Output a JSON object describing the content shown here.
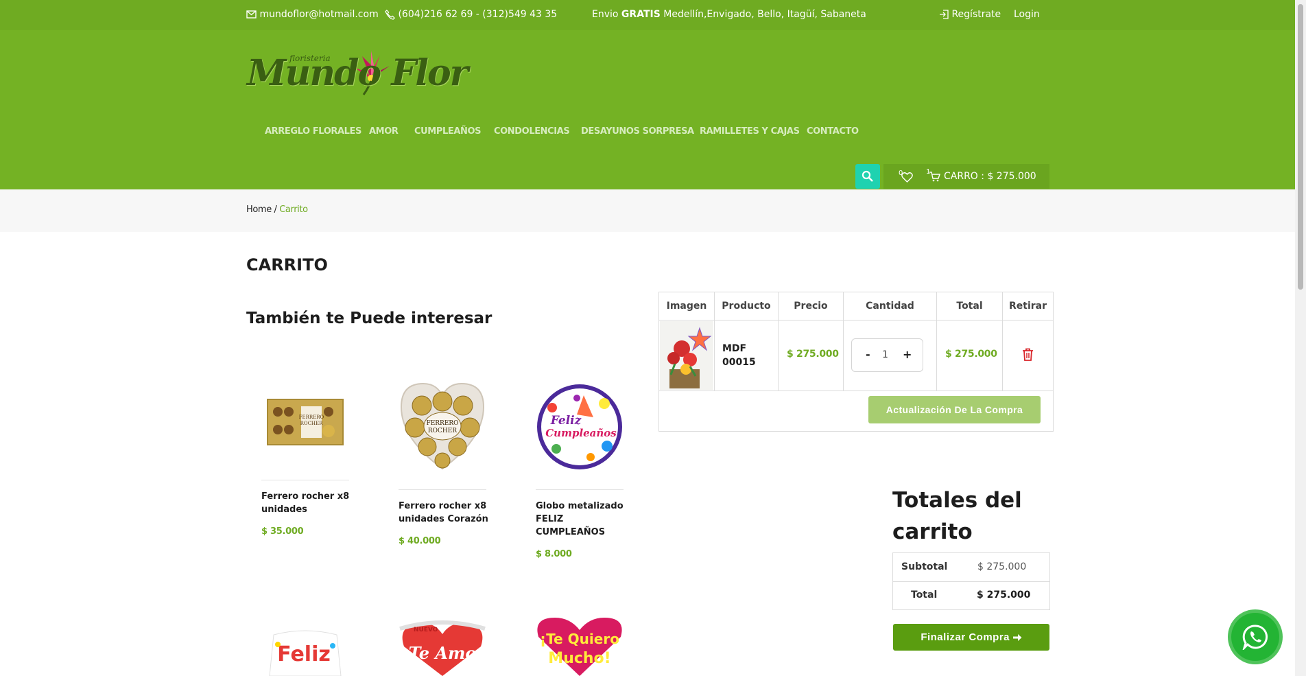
{
  "topbar": {
    "email": "mundoflor@hotmail.com",
    "phone": "(604)216 62 69 - (312)549 43 35",
    "shipping_prefix": "Envio",
    "shipping_bold": "GRATIS",
    "shipping_cities": "Medellín,Envigado, Bello, Itagüí, Sabaneta",
    "register": "Regístrate",
    "login": "Login"
  },
  "logo": {
    "small": "floristeria",
    "main": "Mundo Flor"
  },
  "nav": [
    "ARREGLO FLORALES",
    "AMOR",
    "CUMPLEAÑOS",
    "CONDOLENCIAS",
    "DESAYUNOS SORPRESA",
    "RAMILLETES Y CAJAS",
    "CONTACTO"
  ],
  "header_tools": {
    "wishlist_count": "0",
    "cart_count": "1",
    "cart_label": "CARRO : $ 275.000"
  },
  "breadcrumb": {
    "home": "Home",
    "sep": " / ",
    "current": "Carrito"
  },
  "page_title": "CARRITO",
  "related": {
    "title": "También te Puede interesar",
    "products": [
      {
        "name": "Ferrero rocher x8 unidades",
        "price": "$ 35.000"
      },
      {
        "name": "Ferrero rocher x8 unidades Corazón",
        "price": "$ 40.000"
      },
      {
        "name": "Globo metalizado FELIZ CUMPLEAÑOS",
        "price": "$ 8.000"
      }
    ],
    "balloon_text": {
      "feliz": "Feliz",
      "cumple": "Cumpleaños",
      "teamo": "Te Amo",
      "nuevo": "NUEVO",
      "quiero": "¡Te Quiero",
      "mucho": "Mucho!"
    },
    "ferrero": {
      "line1": "FERRERO",
      "line2": "ROCHER"
    }
  },
  "cart": {
    "headers": [
      "Imagen",
      "Producto",
      "Precio",
      "Cantidad",
      "Total",
      "Retirar"
    ],
    "item": {
      "product": "MDF 00015",
      "price": "$ 275.000",
      "qty": "1",
      "total": "$ 275.000"
    },
    "update_button": "Actualización De La Compra",
    "minus": "-",
    "plus": "+"
  },
  "totals": {
    "title": "Totales del carrito",
    "subtotal_label": "Subtotal",
    "subtotal_value": "$ 275.000",
    "total_label": "Total",
    "total_value": "$ 275.000",
    "checkout_button": "Finalizar Compra"
  },
  "colors": {
    "brand_green": "#74b224",
    "price_green": "#6fab22",
    "search_teal": "#1fd2b0",
    "delete_red": "#d9262b"
  }
}
